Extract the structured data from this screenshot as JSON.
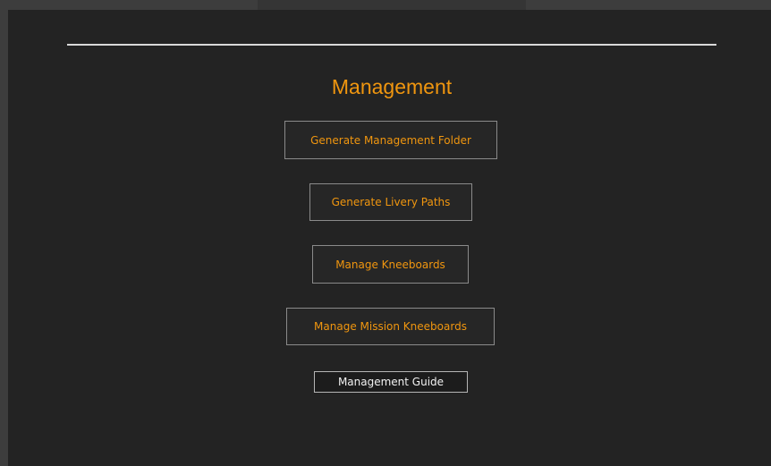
{
  "colors": {
    "background": "#232323",
    "frame": "#3d3d3d",
    "accent": "#f0960f",
    "button_border": "#8a8a8a",
    "divider": "#d9d9d9"
  },
  "section": {
    "title": "Management"
  },
  "buttons": {
    "generate_folder": "Generate Management Folder",
    "generate_livery": "Generate Livery Paths",
    "manage_kneeboards": "Manage Kneeboards",
    "manage_mission_kneeboards": "Manage Mission Kneeboards",
    "management_guide": "Management Guide"
  }
}
